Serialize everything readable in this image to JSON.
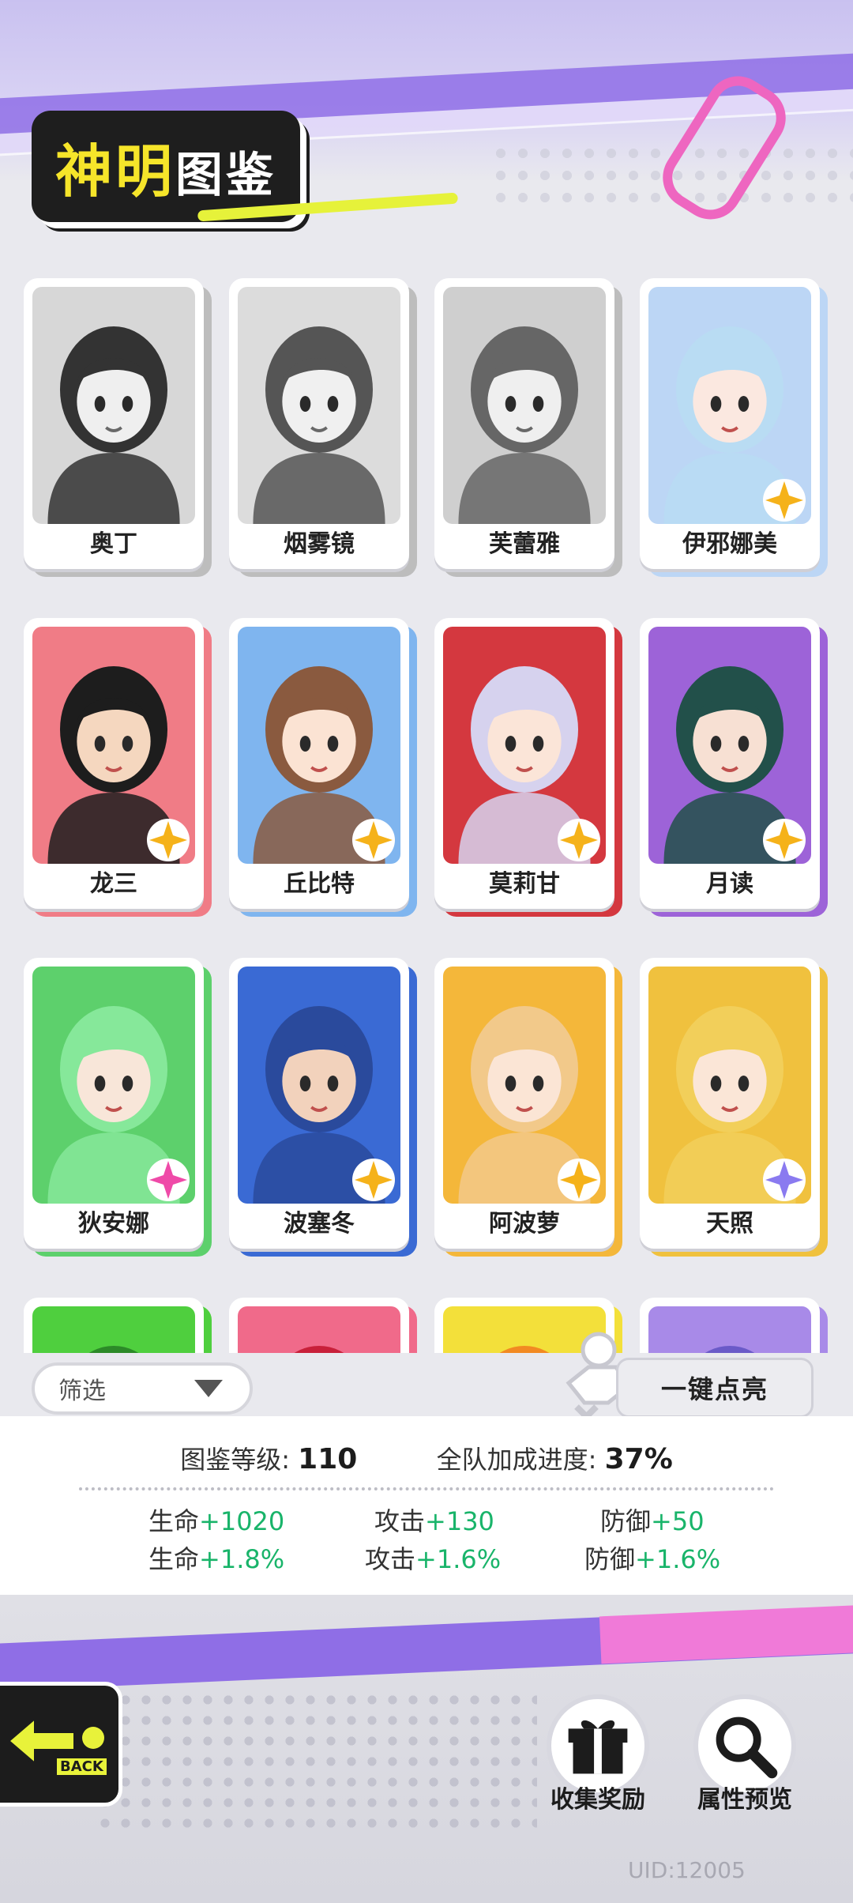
{
  "header": {
    "title_part1": "神明",
    "title_part2": "图鉴"
  },
  "cards": [
    {
      "name": "奥丁",
      "owned": false,
      "rarity": "none",
      "bg": "#d7d7d7",
      "hair": "#333333",
      "skin": "#efefef"
    },
    {
      "name": "烟雾镜",
      "owned": false,
      "rarity": "none",
      "bg": "#dcdcdc",
      "hair": "#555555",
      "skin": "#f0f0f0"
    },
    {
      "name": "芙蕾雅",
      "owned": false,
      "rarity": "none",
      "bg": "#cfcfcf",
      "hair": "#666666",
      "skin": "#efefef"
    },
    {
      "name": "伊邪娜美",
      "owned": true,
      "rarity": "gold",
      "bg": "#bcd6f5",
      "hair": "#b9dcf3",
      "skin": "#fbe8e0"
    },
    {
      "name": "龙三",
      "owned": true,
      "rarity": "gold",
      "bg": "#f07c86",
      "hair": "#1d1d1d",
      "skin": "#f5d7bf"
    },
    {
      "name": "丘比特",
      "owned": true,
      "rarity": "gold",
      "bg": "#7fb5ef",
      "hair": "#8a5a3f",
      "skin": "#fbe3d3"
    },
    {
      "name": "莫莉甘",
      "owned": true,
      "rarity": "gold",
      "bg": "#d4383f",
      "hair": "#d6d2ee",
      "skin": "#fbe5d8"
    },
    {
      "name": "月读",
      "owned": true,
      "rarity": "gold",
      "bg": "#9d63d8",
      "hair": "#22504a",
      "skin": "#f7e0d3"
    },
    {
      "name": "狄安娜",
      "owned": true,
      "rarity": "pink",
      "bg": "#5dd06c",
      "hair": "#86e89a",
      "skin": "#f8e6d9"
    },
    {
      "name": "波塞冬",
      "owned": true,
      "rarity": "gold",
      "bg": "#3a6ad4",
      "hair": "#2a4a9c",
      "skin": "#f2d2bc"
    },
    {
      "name": "阿波萝",
      "owned": true,
      "rarity": "gold",
      "bg": "#f4b73a",
      "hair": "#f2c98a",
      "skin": "#fbe5d5"
    },
    {
      "name": "天照",
      "owned": true,
      "rarity": "purple",
      "bg": "#f0c13e",
      "hair": "#f2cf5a",
      "skin": "#fbe6d7"
    },
    {
      "name": "",
      "owned": true,
      "rarity": "none",
      "bg": "#4fcf3e",
      "hair": "#2c8a28",
      "skin": "#f5e0d0"
    },
    {
      "name": "",
      "owned": true,
      "rarity": "none",
      "bg": "#f06a8a",
      "hair": "#c8203a",
      "skin": "#f5e0d0"
    },
    {
      "name": "",
      "owned": true,
      "rarity": "none",
      "bg": "#f3e03a",
      "hair": "#f28a22",
      "skin": "#f5e0d0"
    },
    {
      "name": "",
      "owned": true,
      "rarity": "none",
      "bg": "#a88ae8",
      "hair": "#6a5ac8",
      "skin": "#f5e0d0"
    }
  ],
  "filter": {
    "label": "筛选"
  },
  "light_button": {
    "label": "一键点亮"
  },
  "stats": {
    "level_label": "图鉴等级:",
    "level_value": "110",
    "progress_label": "全队加成进度:",
    "progress_value": "37%",
    "row1": [
      {
        "label": "生命",
        "value": "+1020"
      },
      {
        "label": "攻击",
        "value": "+130"
      },
      {
        "label": "防御",
        "value": "+50"
      }
    ],
    "row2": [
      {
        "label": "生命",
        "value": "+1.8%"
      },
      {
        "label": "攻击",
        "value": "+1.6%"
      },
      {
        "label": "防御",
        "value": "+1.6%"
      }
    ]
  },
  "footer": {
    "back_label": "BACK",
    "collect_label": "收集奖励",
    "preview_label": "属性预览",
    "uid": "UID:12005"
  },
  "colors": {
    "accent_purple": "#8f6ee6",
    "accent_pink": "#f07ad8",
    "title_yellow": "#f6e52a",
    "stat_green": "#19b46a"
  }
}
